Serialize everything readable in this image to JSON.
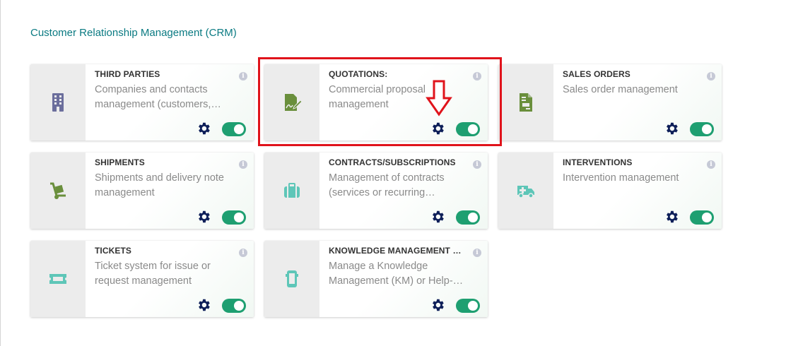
{
  "section": {
    "title": "Customer Relationship Management (CRM)"
  },
  "colors": {
    "accent": "#0a7a82",
    "toggle_on": "#1e9f71",
    "gear": "#0e1f59",
    "highlight": "#e0131b",
    "icon_purple": "#6b6e9c",
    "icon_green": "#6a8f3c",
    "icon_teal": "#5ec6b8"
  },
  "modules": [
    {
      "title": "THIRD PARTIES",
      "description": "Companies and contacts management (customers,…",
      "icon": "building-icon",
      "info": "i",
      "enabled": true
    },
    {
      "title": "QUOTATIONS:",
      "description": "Commercial proposal management",
      "icon": "signed-document-icon",
      "info": "i",
      "enabled": true
    },
    {
      "title": "SALES ORDERS",
      "description": "Sales order management",
      "icon": "file-invoice-icon",
      "info": "i",
      "enabled": true
    },
    {
      "title": "SHIPMENTS",
      "description": "Shipments and delivery note management",
      "icon": "dolly-icon",
      "info": "i",
      "enabled": true
    },
    {
      "title": "CONTRACTS/SUBSCRIPTIONS",
      "description": "Management of contracts (services or recurring…",
      "icon": "suitcase-icon",
      "info": "i",
      "enabled": true
    },
    {
      "title": "INTERVENTIONS",
      "description": "Intervention management",
      "icon": "ambulance-icon",
      "info": "i",
      "enabled": true
    },
    {
      "title": "TICKETS",
      "description": "Ticket system for issue or request management",
      "icon": "ticket-icon",
      "info": "i",
      "enabled": true
    },
    {
      "title": "KNOWLEDGE MANAGEMENT SY…",
      "description": "Manage a Knowledge Management (KM) or Help-De…",
      "icon": "mobile-icon",
      "info": "i",
      "enabled": true
    }
  ],
  "annotation": {
    "highlighted_module": "QUOTATIONS:",
    "arrow_target": "settings-gear"
  }
}
